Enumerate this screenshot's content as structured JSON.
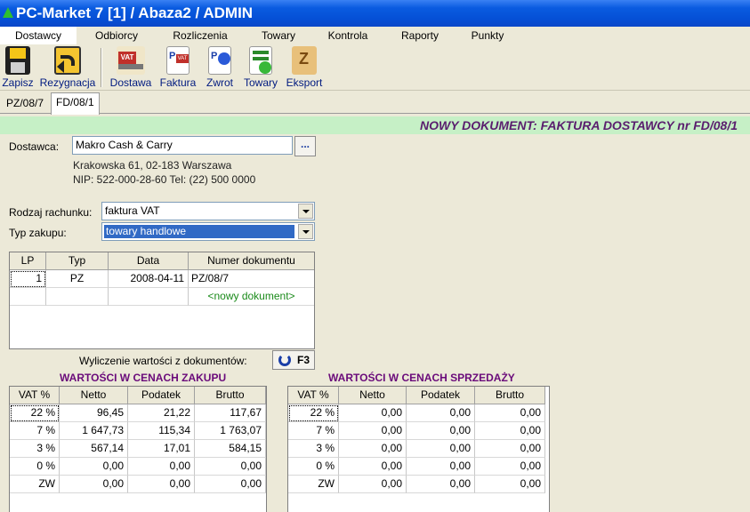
{
  "window": {
    "title": "PC-Market 7 [1] / Abaza2 / ADMIN"
  },
  "menu": [
    "Dostawcy",
    "Odbiorcy",
    "Rozliczenia",
    "Towary",
    "Kontrola",
    "Raporty",
    "Punkty"
  ],
  "toolbar": {
    "items": [
      {
        "label": "Zapisz",
        "icon": "floppy-save-icon"
      },
      {
        "label": "Rezygnacja",
        "icon": "undo-arrow-icon"
      },
      {
        "label": "Dostawa",
        "icon": "vat-truck-icon"
      },
      {
        "label": "Faktura",
        "icon": "vat-invoice-icon"
      },
      {
        "label": "Zwrot",
        "icon": "return-icon"
      },
      {
        "label": "Towary",
        "icon": "goods-icon"
      },
      {
        "label": "Eksport",
        "icon": "export-icon"
      }
    ]
  },
  "tabs": [
    "PZ/08/7",
    "FD/08/1"
  ],
  "header": {
    "title": "NOWY DOKUMENT: FAKTURA DOSTAWCY nr FD/08/1"
  },
  "form": {
    "supplier_label": "Dostawca:",
    "supplier_value": "Makro Cash & Carry",
    "supplier_button": "...",
    "address": "Krakowska 61, 02-183 Warszawa",
    "nip": "NIP: 522-000-28-60 Tel: (22) 500 0000",
    "account_type_label": "Rodzaj rachunku:",
    "account_type_value": "faktura VAT",
    "purchase_type_label": "Typ zakupu:",
    "purchase_type_value": "towary handlowe"
  },
  "docs_table": {
    "columns": [
      "LP",
      "Typ",
      "Data",
      "Numer dokumentu"
    ],
    "rows": [
      {
        "lp": "1",
        "typ": "PZ",
        "data": "2008-04-11",
        "numer": "PZ/08/7"
      }
    ],
    "new_row": "<nowy dokument>"
  },
  "calc": {
    "label": "Wyliczenie wartości z dokumentów:",
    "button": "F3"
  },
  "purchase": {
    "title": "WARTOŚCI W CENACH ZAKUPU",
    "columns": [
      "VAT %",
      "Netto",
      "Podatek",
      "Brutto"
    ],
    "rows": [
      [
        "22 %",
        "96,45",
        "21,22",
        "117,67"
      ],
      [
        "7 %",
        "1 647,73",
        "115,34",
        "1 763,07"
      ],
      [
        "3 %",
        "567,14",
        "17,01",
        "584,15"
      ],
      [
        "0 %",
        "0,00",
        "0,00",
        "0,00"
      ],
      [
        "ZW",
        "0,00",
        "0,00",
        "0,00"
      ]
    ]
  },
  "sales": {
    "title": "WARTOŚCI W CENACH SPRZEDAŻY",
    "columns": [
      "VAT %",
      "Netto",
      "Podatek",
      "Brutto"
    ],
    "rows": [
      [
        "22 %",
        "0,00",
        "0,00",
        "0,00"
      ],
      [
        "7 %",
        "0,00",
        "0,00",
        "0,00"
      ],
      [
        "3 %",
        "0,00",
        "0,00",
        "0,00"
      ],
      [
        "0 %",
        "0,00",
        "0,00",
        "0,00"
      ],
      [
        "ZW",
        "0,00",
        "0,00",
        "0,00"
      ]
    ]
  }
}
